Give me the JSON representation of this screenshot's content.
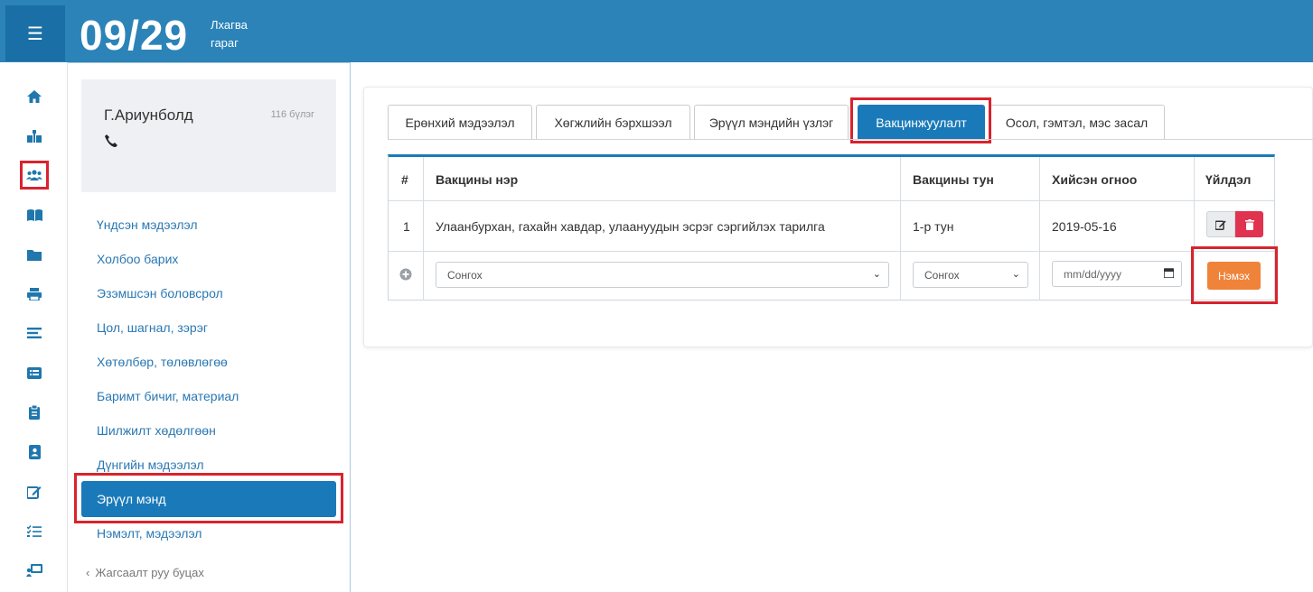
{
  "header": {
    "menu_icon": "hamburger-icon",
    "day_number": "09/29",
    "day_name": "Лхагва гараг"
  },
  "rail": {
    "icons": [
      "home-icon",
      "sitemap-icon",
      "users-icon",
      "book-icon",
      "folder-icon",
      "print-icon",
      "list-icon",
      "list-alt-icon",
      "clipboard-icon",
      "address-book-icon",
      "edit-icon",
      "tasks-icon",
      "chalkboard-icon"
    ],
    "active_index": 2
  },
  "sidebar": {
    "profile": {
      "name": "Г.Ариунболд",
      "unit": "116 бүлэг",
      "phone_icon": "phone-icon"
    },
    "items": [
      {
        "label": "Үндсэн мэдээлэл"
      },
      {
        "label": "Холбоо барих"
      },
      {
        "label": "Эзэмшсэн боловсрол"
      },
      {
        "label": "Цол, шагнал, зэрэг"
      },
      {
        "label": "Хөтөлбөр, төлөвлөгөө"
      },
      {
        "label": "Баримт бичиг, материал"
      },
      {
        "label": "Шилжилт хөдөлгөөн"
      },
      {
        "label": "Дүнгийн мэдээлэл"
      },
      {
        "label": "Эрүүл мэнд"
      },
      {
        "label": "Нэмэлт, мэдээлэл"
      }
    ],
    "active_label": "Эрүүл мэнд",
    "back_label": "Жагсаалт руу буцах"
  },
  "tabs": [
    {
      "label": "Ерөнхий мэдээлэл"
    },
    {
      "label": "Хөгжлийн бэрхшээл"
    },
    {
      "label": "Эрүүл мэндийн үзлэг"
    },
    {
      "label": "Вакцинжуулалт"
    },
    {
      "label": "Осол, гэмтэл, мэс засал"
    }
  ],
  "active_tab": "Вакцинжуулалт",
  "table": {
    "headers": {
      "num": "#",
      "name": "Вакцины нэр",
      "dose": "Вакцины тун",
      "date": "Хийсэн огноо",
      "action": "Үйлдэл"
    },
    "rows": [
      {
        "num": "1",
        "name": "Улаанбурхан, гахайн хавдар, улаануудын эсрэг сэргийлэх тарилга",
        "dose": "1-р тун",
        "date": "2019-05-16"
      }
    ],
    "new_row": {
      "name_select": "Сонгох",
      "dose_select": "Сонгох",
      "date_placeholder": "mm/dd/yyyy",
      "add_label": "Нэмэх"
    }
  },
  "colors": {
    "header_blue": "#2b83b8",
    "active_blue": "#1a7ab9",
    "link_blue": "#2a78b3",
    "add_orange": "#f0833a",
    "delete_red": "#e0334f",
    "highlight_red": "#d9232d"
  }
}
